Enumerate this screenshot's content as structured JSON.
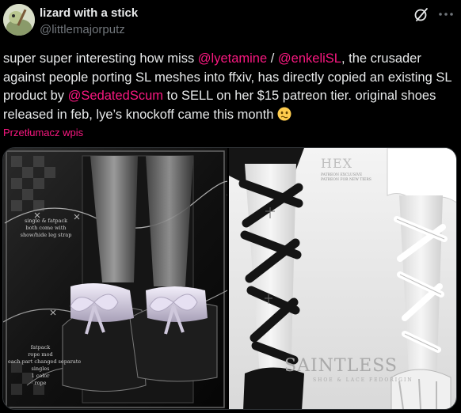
{
  "author": {
    "display_name": "lizard with a stick",
    "handle": "@littlemajorputz",
    "avatar_icon": "avatar-icon"
  },
  "header_icons": {
    "grok": "grok-icon",
    "more": "more-icon"
  },
  "tweet": {
    "segments": [
      {
        "t": "super super interesting how miss ",
        "mention": false
      },
      {
        "t": "@lyetamine",
        "mention": true
      },
      {
        "t": " / ",
        "mention": false
      },
      {
        "t": "@enkeliSL",
        "mention": true
      },
      {
        "t": ", the crusader against people porting SL meshes into ffxiv, has directly copied an existing SL product by ",
        "mention": false
      },
      {
        "t": "@SedatedScum",
        "mention": true
      },
      {
        "t": " to SELL on her $15 patreon tier. original shoes released in feb, lye’s knockoff came this month ",
        "mention": false
      }
    ],
    "emoji": "pleading-wobbly-face-emoji",
    "translate_label": "Przetłumacz wpis"
  },
  "media": {
    "left_image": {
      "text_top": [
        "single & fatpack",
        "both come with",
        "show/hide leg strap"
      ],
      "text_bottom": [
        "fatpack",
        "rope mod",
        "each part changed separate",
        "singles",
        "1 color",
        "rope"
      ]
    },
    "right_image": {
      "brand": "HEX",
      "brand_lines": [
        "PATREON EXCLUSIVE",
        "PATREON FOR NEW TIERS"
      ],
      "product": "SAINTLESS",
      "product_sub": "SHOE & LACE FEDORIGIN"
    }
  },
  "colors": {
    "background": "#000000",
    "text": "#e7e9ea",
    "secondary": "#71767b",
    "mention": "#f91880",
    "border": "#2f3336"
  }
}
